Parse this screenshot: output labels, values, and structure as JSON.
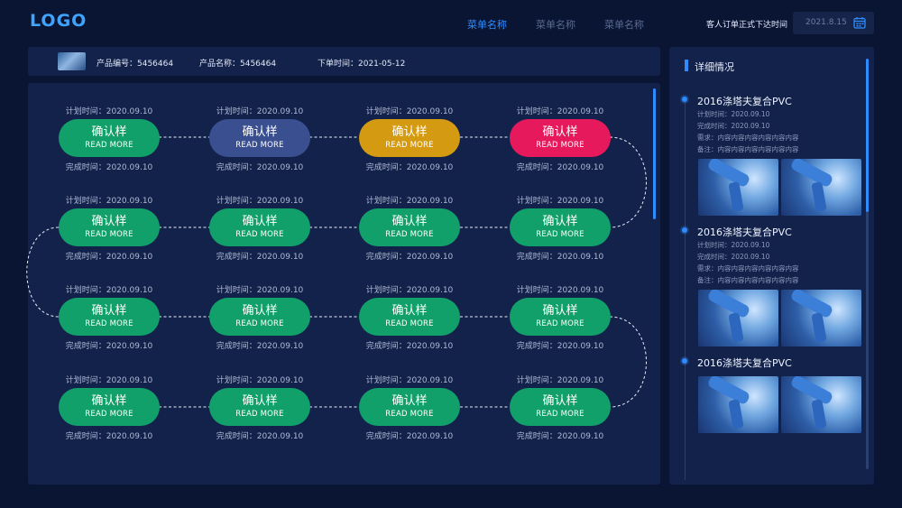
{
  "header": {
    "logo": "LOGO",
    "nav": [
      "菜单名称",
      "菜单名称",
      "菜单名称"
    ],
    "order_label": "客人订单正式下达时间",
    "date": "2021.8.15"
  },
  "product": {
    "code": "产品编号：5456464",
    "name": "产品名称：5456464",
    "order_time": "下单时间：2021-05-12"
  },
  "nodes": [
    {
      "plan": "计划时间：2020.09.10",
      "title": "确认样",
      "sub": "READ MORE",
      "done": "完成时间：2020.09.10",
      "color": "#12a06a"
    },
    {
      "plan": "计划时间：2020.09.10",
      "title": "确认样",
      "sub": "READ MORE",
      "done": "完成时间：2020.09.10",
      "color": "#3a4f8f"
    },
    {
      "plan": "计划时间：2020.09.10",
      "title": "确认样",
      "sub": "READ MORE",
      "done": "完成时间：2020.09.10",
      "color": "#d49a12"
    },
    {
      "plan": "计划时间：2020.09.10",
      "title": "确认样",
      "sub": "READ MORE",
      "done": "完成时间：2020.09.10",
      "color": "#e5195c"
    },
    {
      "plan": "计划时间：2020.09.10",
      "title": "确认样",
      "sub": "READ MORE",
      "done": "完成时间：2020.09.10",
      "color": "#12a06a"
    },
    {
      "plan": "计划时间：2020.09.10",
      "title": "确认样",
      "sub": "READ MORE",
      "done": "完成时间：2020.09.10",
      "color": "#12a06a"
    },
    {
      "plan": "计划时间：2020.09.10",
      "title": "确认样",
      "sub": "READ MORE",
      "done": "完成时间：2020.09.10",
      "color": "#12a06a"
    },
    {
      "plan": "计划时间：2020.09.10",
      "title": "确认样",
      "sub": "READ MORE",
      "done": "完成时间：2020.09.10",
      "color": "#12a06a"
    },
    {
      "plan": "计划时间：2020.09.10",
      "title": "确认样",
      "sub": "READ MORE",
      "done": "完成时间：2020.09.10",
      "color": "#12a06a"
    },
    {
      "plan": "计划时间：2020.09.10",
      "title": "确认样",
      "sub": "READ MORE",
      "done": "完成时间：2020.09.10",
      "color": "#12a06a"
    },
    {
      "plan": "计划时间：2020.09.10",
      "title": "确认样",
      "sub": "READ MORE",
      "done": "完成时间：2020.09.10",
      "color": "#12a06a"
    },
    {
      "plan": "计划时间：2020.09.10",
      "title": "确认样",
      "sub": "READ MORE",
      "done": "完成时间：2020.09.10",
      "color": "#12a06a"
    },
    {
      "plan": "计划时间：2020.09.10",
      "title": "确认样",
      "sub": "READ MORE",
      "done": "完成时间：2020.09.10",
      "color": "#12a06a"
    },
    {
      "plan": "计划时间：2020.09.10",
      "title": "确认样",
      "sub": "READ MORE",
      "done": "完成时间：2020.09.10",
      "color": "#12a06a"
    },
    {
      "plan": "计划时间：2020.09.10",
      "title": "确认样",
      "sub": "READ MORE",
      "done": "完成时间：2020.09.10",
      "color": "#12a06a"
    },
    {
      "plan": "计划时间：2020.09.10",
      "title": "确认样",
      "sub": "READ MORE",
      "done": "完成时间：2020.09.10",
      "color": "#12a06a"
    }
  ],
  "side": {
    "title": "详细情况",
    "entries": [
      {
        "title": "2016涤塔夫复合PVC",
        "lines": [
          "计划时间：2020.09.10",
          "完成时间：2020.09.10",
          "需求：内容内容内容内容内容内容",
          "备注：内容内容内容内容内容内容"
        ]
      },
      {
        "title": "2016涤塔夫复合PVC",
        "lines": [
          "计划时间：2020.09.10",
          "完成时间：2020.09.10",
          "需求：内容内容内容内容内容内容",
          "备注：内容内容内容内容内容内容"
        ]
      },
      {
        "title": "2016涤塔夫复合PVC",
        "lines": []
      }
    ]
  },
  "icons": {
    "calendar": "calendar-icon"
  }
}
